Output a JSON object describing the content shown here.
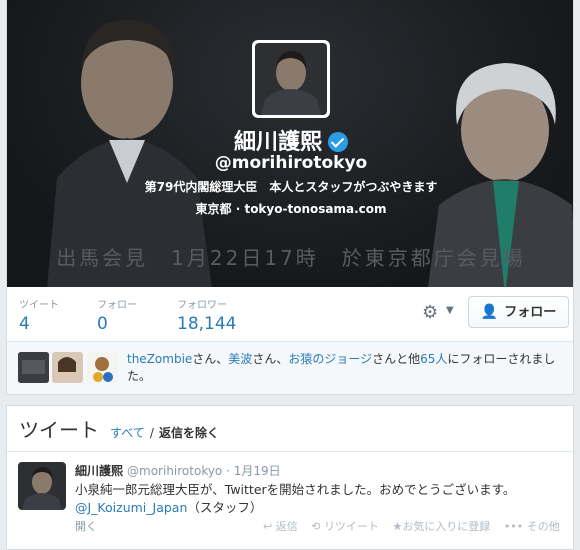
{
  "profile": {
    "name": "細川護熙",
    "handle": "@morihirotokyo",
    "bio": "第79代内閣総理大臣　本人とスタッフがつぶやきます",
    "location": "東京都",
    "location_sep": "·",
    "url": "tokyo-tonosama.com",
    "banner_caption": "出馬会見　1月22日17時　於東京都庁会見場"
  },
  "stats": [
    {
      "label": "ツイート",
      "value": "4"
    },
    {
      "label": "フォロー",
      "value": "0"
    },
    {
      "label": "フォロワー",
      "value": "18,144"
    }
  ],
  "actions": {
    "follow_label": "フォロー"
  },
  "mutual": {
    "user1": "theZombie",
    "suffix1": "さん、",
    "user2": "美波",
    "suffix2": "さん、",
    "user3": "お猿のジョージ",
    "suffix3": "さんと他",
    "others": "65人",
    "tail": "にフォローされました。"
  },
  "tweets_section": {
    "title": "ツイート",
    "filter_all": "すべて",
    "filter_sep": "/",
    "filter_noreplies": "返信を除く"
  },
  "tweet": {
    "name": "細川護熙",
    "handle": "@morihirotokyo",
    "date": "· 1月19日",
    "text": "小泉純一郎元総理大臣が、Twitterを開始されました。おめでとうございます。",
    "mention": "@J_Koizumi_Japan",
    "suffix": "（スタッフ）",
    "open": "開く",
    "reply": "返信",
    "retweet": "リツイート",
    "favorite": "お気に入りに登録",
    "more": "その他"
  },
  "colors": {
    "link": "#2b7bb9",
    "verified": "#2b9de8",
    "banner": "#15171a"
  }
}
